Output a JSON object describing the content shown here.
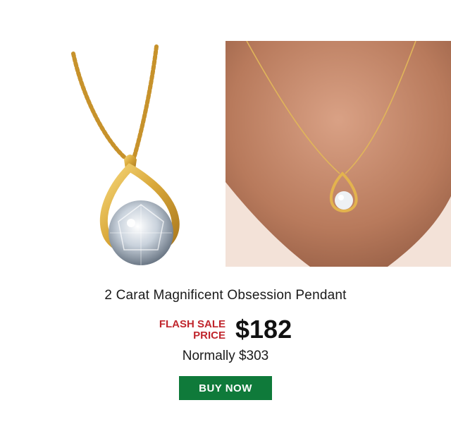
{
  "product": {
    "title": "2 Carat Magnificent Obsession Pendant",
    "sale_label_line1": "FLASH SALE",
    "sale_label_line2": "PRICE",
    "sale_price": "$182",
    "normal_price": "Normally $303"
  },
  "cta": {
    "buy_label": "BUY NOW"
  },
  "colors": {
    "accent_red": "#c0262d",
    "button_green": "#0f7a3a",
    "gold": "#d9a83a"
  }
}
